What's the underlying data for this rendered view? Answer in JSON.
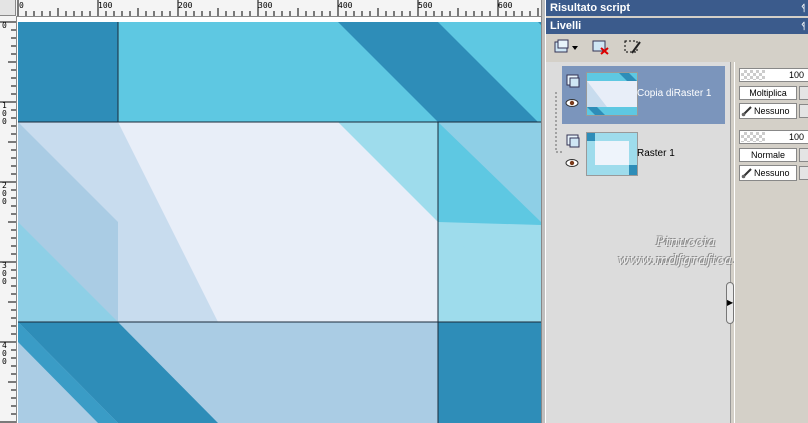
{
  "canvas": {
    "ruler_top_labels": [
      "0",
      "100",
      "200",
      "300",
      "400",
      "500",
      "600"
    ],
    "ruler_left_labels": [
      "0",
      "1\n0\n0",
      "2\n0\n0",
      "3\n0\n0",
      "4\n0\n0"
    ],
    "colors": {
      "dark_blue": "#2e8db8",
      "mid_blue": "#5ec8e2",
      "light_cyan": "#9edcec",
      "pale": "#e8eef8",
      "powder": "#aacce4",
      "soft": "#c8dcee"
    }
  },
  "panels": {
    "script_output": {
      "title": "Risultato script",
      "pin_icon": "pin-icon"
    },
    "layers": {
      "title": "Livelli",
      "toolbar": [
        "new-layer-icon",
        "delete-layer-icon",
        "selection-icon"
      ],
      "items": [
        {
          "name": "Copia diRaster 1",
          "opacity": "100",
          "blend_mode": "Moltiplica",
          "mask": "Nessuno",
          "selected": true
        },
        {
          "name": "Raster 1",
          "opacity": "100",
          "blend_mode": "Normale",
          "mask": "Nessuno",
          "selected": false
        }
      ]
    }
  },
  "watermark": {
    "line1": "Pinuccia",
    "line2": "www.mdfgrafica.eu"
  }
}
